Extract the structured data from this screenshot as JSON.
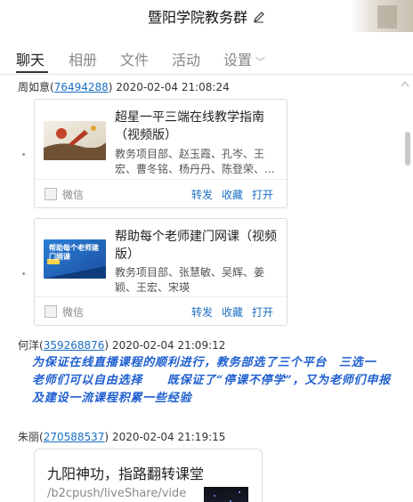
{
  "window": {
    "title": "暨阳学院教务群"
  },
  "tabs": [
    {
      "label": "聊天",
      "active": true
    },
    {
      "label": "相册",
      "active": false
    },
    {
      "label": "文件",
      "active": false
    },
    {
      "label": "活动",
      "active": false
    },
    {
      "label": "设置",
      "active": false
    }
  ],
  "messages": [
    {
      "sender": "周如意",
      "qq": "76494288",
      "time": "2020-02-04 21:08:24",
      "cards": [
        {
          "title": "超星一平三端在线教学指南（视频版）",
          "desc": "教务项目部、赵玉霞、孔岑、王宏、曹冬铭、杨丹丹、陈登荣、...",
          "source": "微信",
          "actions": [
            "转发",
            "收藏",
            "打开"
          ]
        },
        {
          "title": "帮助每个老师建门网课（视频版）",
          "desc": "教务项目部、张慧敏、吴辉、姜颖、王宏、宋瑛",
          "thumb_text": "帮助每个老师建门网课",
          "source": "微信",
          "actions": [
            "转发",
            "收藏",
            "打开"
          ]
        }
      ]
    },
    {
      "sender": "何洋",
      "qq": "359268876",
      "time": "2020-02-04 21:09:12",
      "text": "为保证在线直播课程的顺利进行，教务部选了三个平台　三选一　老师们可以自由选择　　既保证了“停课不停学”，又为老师们申报及建设一流课程积累一些经验"
    },
    {
      "sender": "朱丽",
      "qq": "270588537",
      "time": "2020-02-04 21:19:15",
      "link_card": {
        "title": "九阳神功，指路翻转课堂",
        "url": "/b2cpush/liveShare/vide"
      }
    }
  ],
  "colors": {
    "link_blue": "#1a6ec3",
    "rich_text_blue": "#1f5fd0",
    "border": "#dcdcdc"
  },
  "icons": [
    "edit-icon",
    "chevron-down-icon",
    "collapse-icon",
    "wechat-icon"
  ]
}
